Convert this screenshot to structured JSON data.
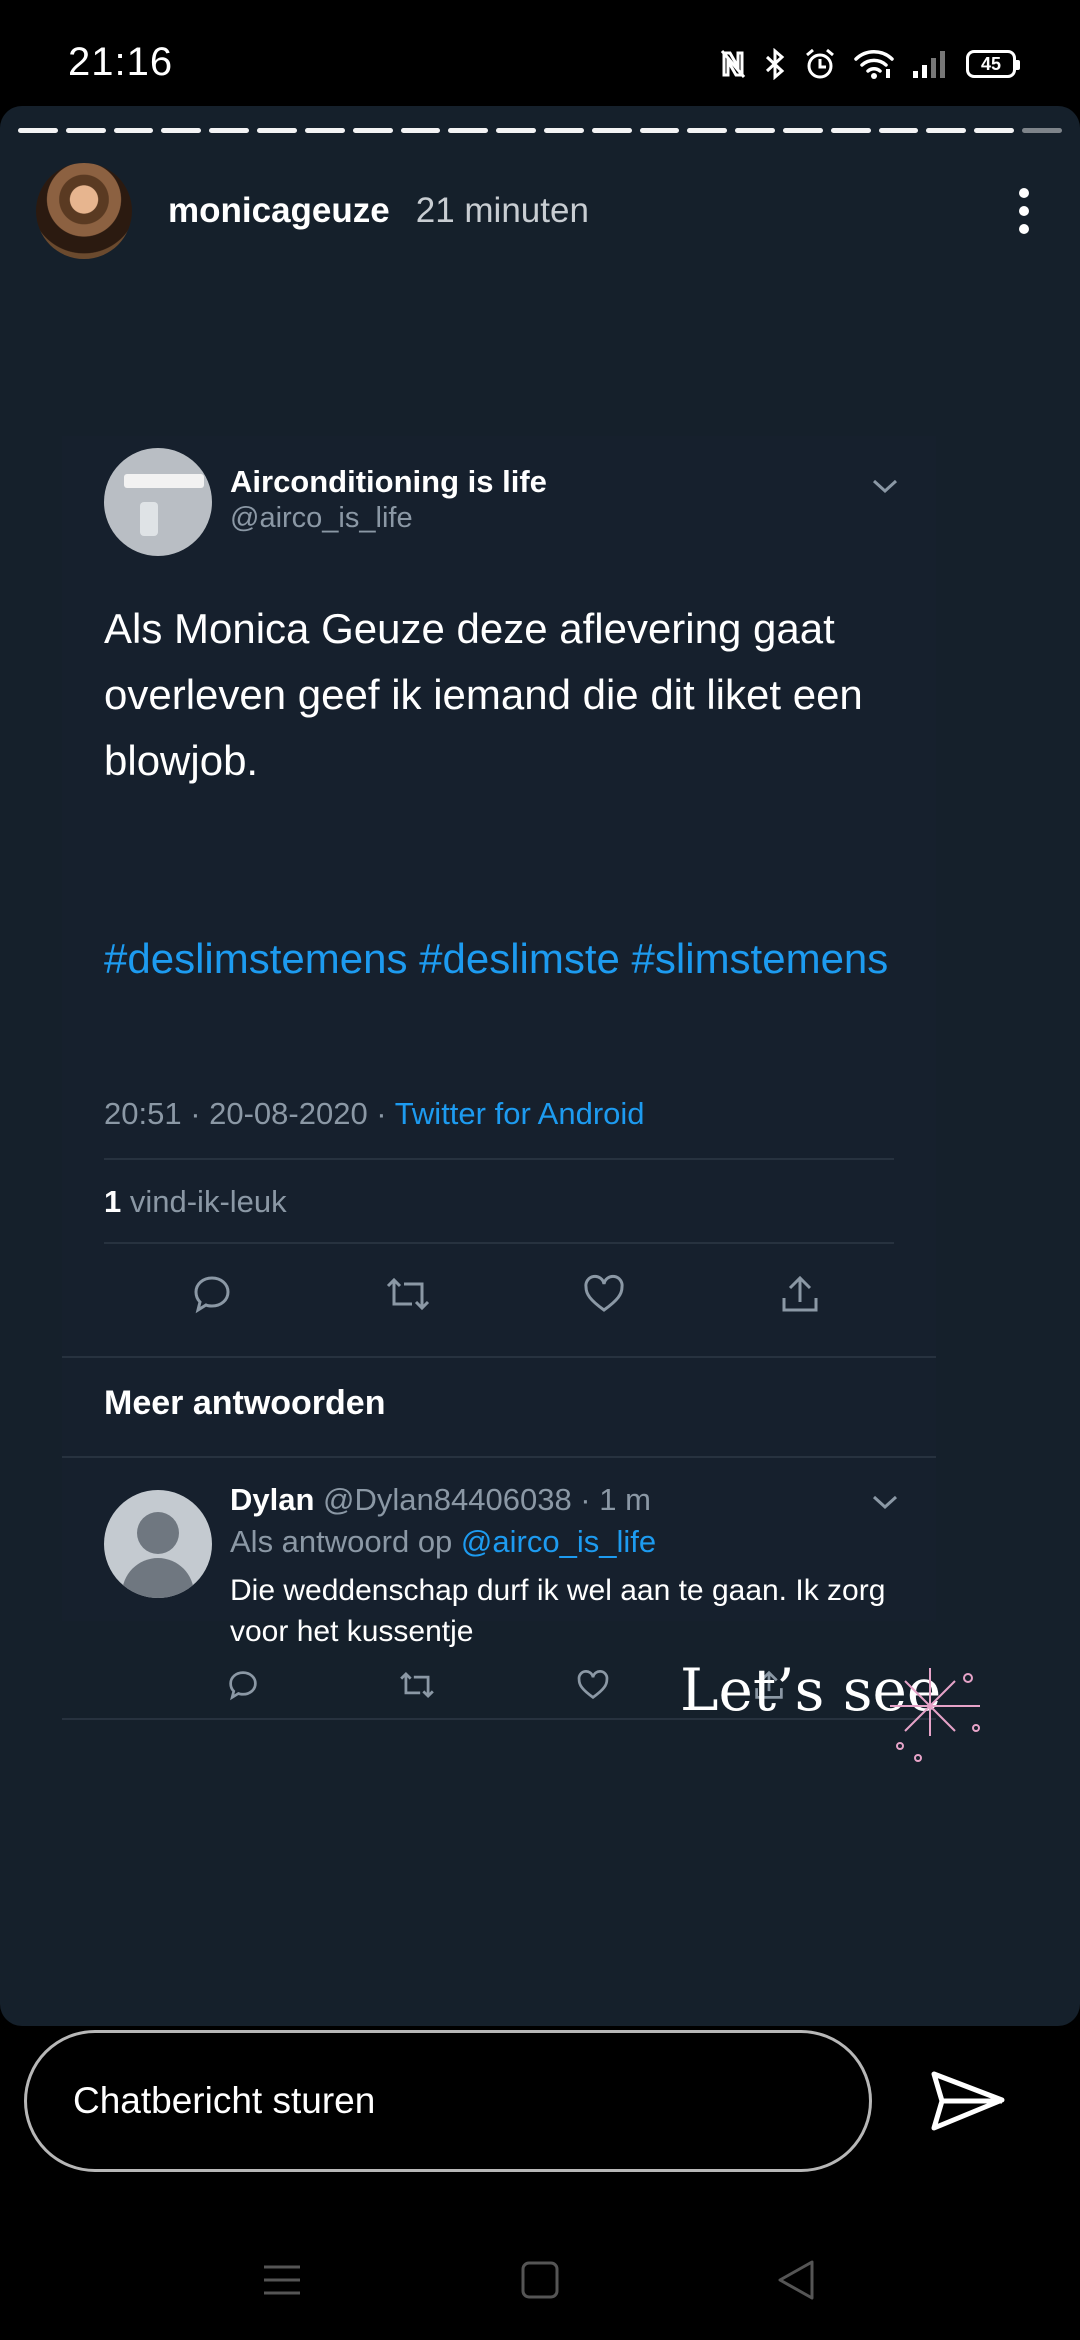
{
  "status_bar": {
    "time": "21:16",
    "battery": "45",
    "icons": [
      "nfc-icon",
      "bluetooth-icon",
      "alarm-icon",
      "wifi-icon",
      "signal-icon",
      "battery-icon"
    ]
  },
  "story": {
    "username": "monicageuze",
    "time_ago": "21 minuten",
    "progress_segments": 22,
    "sticker_text": "Let’s see"
  },
  "tweet": {
    "name": "Airconditioning is life",
    "handle": "@airco_is_life",
    "text": "Als Monica Geuze deze aflevering gaat overleven geef ik iemand die dit liket een blowjob.",
    "hashtags": "#deslimstemens #deslimste #slimstemens",
    "timestamp": "20:51 · 20-08-2020 · ",
    "source": "Twitter for Android",
    "like_count": "1",
    "like_label": " vind-ik-leuk"
  },
  "more_replies_label": "Meer antwoorden",
  "reply": {
    "name": "Dylan",
    "handle_time": " @Dylan84406038 · 1 m",
    "in_reply_prefix": "Als antwoord op ",
    "in_reply_mention": "@airco_is_life",
    "text": "Die weddenschap durf ik wel aan te gaan. Ik zorg voor het kussentje"
  },
  "bottom": {
    "input_placeholder": "Chatbericht sturen"
  },
  "colors": {
    "story_bg": "#15202b",
    "link": "#1d9bf0",
    "secondary_text": "#8b98a5"
  }
}
